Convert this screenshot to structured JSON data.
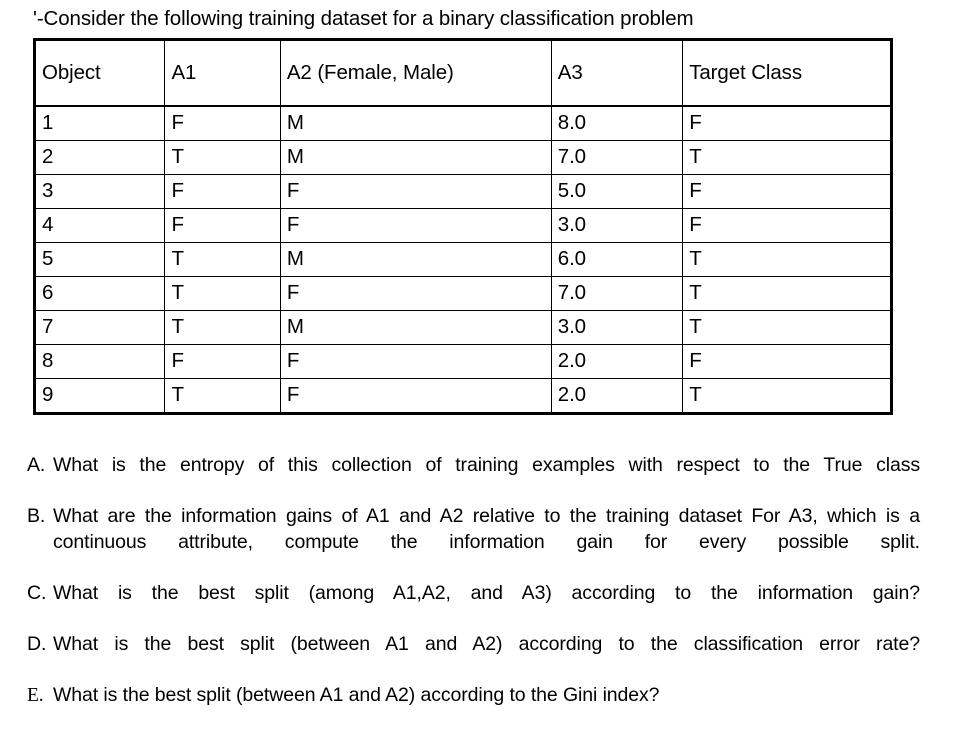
{
  "document": {
    "title_prefix": "'-",
    "title": "'-Consider the following training dataset for a binary classification problem"
  },
  "table": {
    "caption": "Training dataset for a binary classification problem",
    "headers": [
      "Object",
      "A1",
      "A2 (Female, Male)",
      "A3",
      "Target Class"
    ],
    "rows": [
      [
        "1",
        "F",
        "M",
        "8.0",
        "F"
      ],
      [
        "2",
        "T",
        "M",
        "7.0",
        "T"
      ],
      [
        "3",
        "F",
        "F",
        "5.0",
        "F"
      ],
      [
        "4",
        "F",
        "F",
        "3.0",
        "F"
      ],
      [
        "5",
        "T",
        "M",
        "6.0",
        "T"
      ],
      [
        "6",
        "T",
        "F",
        "7.0",
        "T"
      ],
      [
        "7",
        "T",
        "M",
        "3.0",
        "T"
      ],
      [
        "8",
        "F",
        "F",
        "2.0",
        "F"
      ],
      [
        "9",
        "T",
        "F",
        "2.0",
        "T"
      ]
    ]
  },
  "questions": [
    {
      "marker": "A.",
      "text": "What is the entropy of this collection of training examples with respect to the True class"
    },
    {
      "marker": "B.",
      "text": "What are the information gains of A1 and A2 relative to the training dataset For A3, which is a continuous attribute, compute the information gain for every possible split."
    },
    {
      "marker": "C.",
      "text": "What is the best split (among A1,A2, and A3) according to the information gain?"
    },
    {
      "marker": "D.",
      "text": "What is the best split (between A1 and A2) according to the classification error rate?"
    },
    {
      "marker": "E.",
      "text": "What is the best split (between A1 and A2) according to the Gini index?"
    }
  ],
  "colors": {
    "background": "#ffffff",
    "text": "#000000",
    "table_border": "#000000"
  }
}
